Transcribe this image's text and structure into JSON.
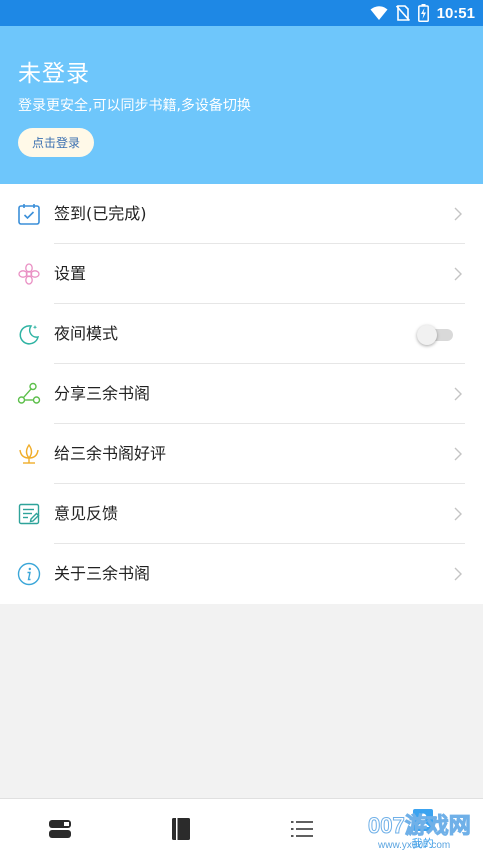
{
  "status_bar": {
    "time": "10:51",
    "icons": [
      "wifi-icon",
      "no-sim-icon",
      "battery-charging-icon"
    ]
  },
  "header": {
    "title": "未登录",
    "subtitle": "登录更安全,可以同步书籍,多设备切换",
    "login_button": "点击登录"
  },
  "menu": {
    "items": [
      {
        "label": "签到(已完成)",
        "icon": "calendar-check-icon"
      },
      {
        "label": "设置",
        "icon": "flower-gear-icon"
      },
      {
        "label": "夜间模式",
        "icon": "moon-icon",
        "toggle": false
      },
      {
        "label": "分享三余书阁",
        "icon": "share-icon"
      },
      {
        "label": "给三余书阁好评",
        "icon": "lotus-icon"
      },
      {
        "label": "意见反馈",
        "icon": "feedback-icon"
      },
      {
        "label": "关于三余书阁",
        "icon": "info-icon"
      }
    ]
  },
  "bottom_nav": {
    "tabs": [
      {
        "icon": "bookshelf-icon",
        "label": ""
      },
      {
        "icon": "book-icon",
        "label": ""
      },
      {
        "icon": "list-icon",
        "label": ""
      },
      {
        "icon": "profile-icon",
        "label": "我的",
        "active": true
      }
    ]
  },
  "watermark": {
    "big": "007游戏网",
    "small": "www.yx007.com"
  },
  "colors": {
    "status_bar": "#1e88e5",
    "header": "#6ec6fb",
    "accent": "#3ba3f0"
  }
}
